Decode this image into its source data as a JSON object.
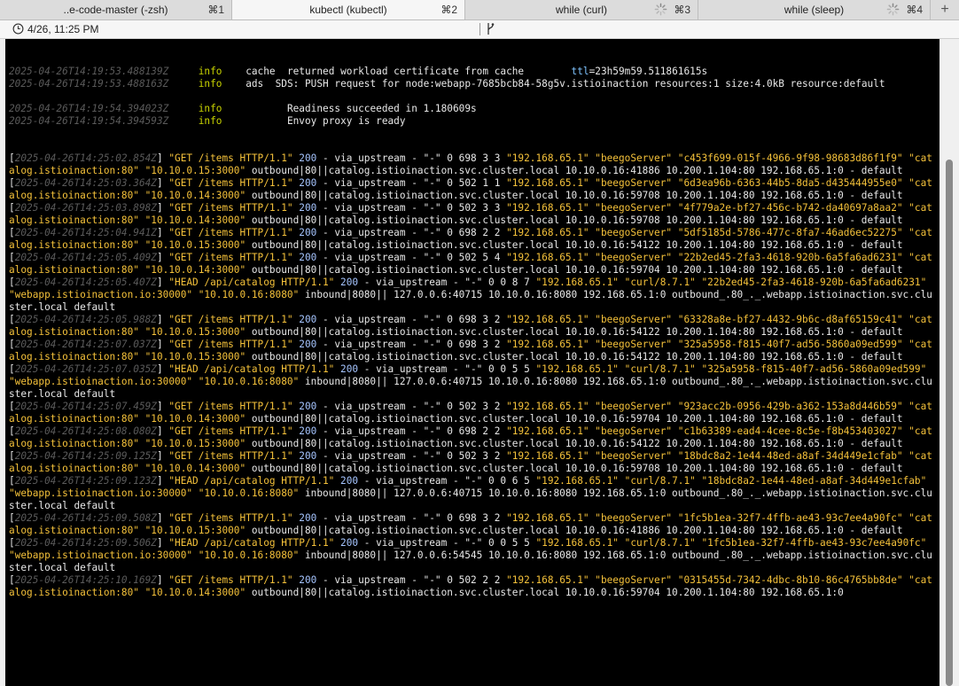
{
  "tabs": [
    {
      "title": "..e-code-master (-zsh)",
      "shortcut": "⌘1",
      "active": false,
      "busy": false
    },
    {
      "title": "kubectl (kubectl)",
      "shortcut": "⌘2",
      "active": true,
      "busy": false
    },
    {
      "title": "while (curl)",
      "shortcut": "⌘3",
      "active": false,
      "busy": true
    },
    {
      "title": "while (sleep)",
      "shortcut": "⌘4",
      "active": false,
      "busy": true
    }
  ],
  "new_tab_label": "+",
  "infobar": {
    "date": "4/26, 11:25 PM"
  },
  "colors": {
    "terminal_bg": "#000000",
    "request": "#f4c13a",
    "timestamp": "#5a5a5a",
    "status": "#a6c5ff",
    "level": "#c9d400"
  },
  "system_logs": [
    {
      "ts": "2025-04-26T14:19:53.488139Z",
      "level": "info",
      "scope": "cache",
      "msg": "returned workload certificate from cache        ",
      "ttl_key": "ttl",
      "ttl_val": "=23h59m59.511861615s"
    },
    {
      "ts": "2025-04-26T14:19:53.488163Z",
      "level": "info",
      "scope": "ads",
      "msg": "SDS: PUSH request for node:webapp-7685bcb84-58g5v.istioinaction resources:1 size:4.0kB resource:default",
      "ttl_key": "",
      "ttl_val": ""
    },
    {
      "ts": "2025-04-26T14:19:54.394023Z",
      "level": "info",
      "scope": "     ",
      "msg": "Readiness succeeded in 1.180609s",
      "ttl_key": "",
      "ttl_val": ""
    },
    {
      "ts": "2025-04-26T14:19:54.394593Z",
      "level": "info",
      "scope": "     ",
      "msg": "Envoy proxy is ready",
      "ttl_key": "",
      "ttl_val": ""
    }
  ],
  "access_logs": [
    {
      "ts": "2025-04-26T14:25:02.854Z",
      "req": "\"GET /items HTTP/1.1\"",
      "status": "200",
      "mid": " - via_upstream - \"-\" 0 698 3 3 ",
      "quoted": "\"192.168.65.1\" \"beegoServer\" \"c453f699-015f-4966-9f98-98683d86f1f9\" \"catalog.istioinaction:80\" \"10.10.0.15:3000\"",
      "tail": " outbound|80||catalog.istioinaction.svc.cluster.local 10.10.0.16:41886 10.200.1.104:80 192.168.65.1:0 - default"
    },
    {
      "ts": "2025-04-26T14:25:03.364Z",
      "req": "\"GET /items HTTP/1.1\"",
      "status": "200",
      "mid": " - via_upstream - \"-\" 0 502 1 1 ",
      "quoted": "\"192.168.65.1\" \"beegoServer\" \"6d3ea96b-6363-44b5-8da5-d435444955e0\" \"catalog.istioinaction:80\" \"10.10.0.14:3000\"",
      "tail": " outbound|80||catalog.istioinaction.svc.cluster.local 10.10.0.16:59708 10.200.1.104:80 192.168.65.1:0 - default"
    },
    {
      "ts": "2025-04-26T14:25:03.898Z",
      "req": "\"GET /items HTTP/1.1\"",
      "status": "200",
      "mid": " - via_upstream - \"-\" 0 502 3 3 ",
      "quoted": "\"192.168.65.1\" \"beegoServer\" \"4f779a2e-bf27-456c-b742-da40697a8aa2\" \"catalog.istioinaction:80\" \"10.10.0.14:3000\"",
      "tail": " outbound|80||catalog.istioinaction.svc.cluster.local 10.10.0.16:59708 10.200.1.104:80 192.168.65.1:0 - default"
    },
    {
      "ts": "2025-04-26T14:25:04.941Z",
      "req": "\"GET /items HTTP/1.1\"",
      "status": "200",
      "mid": " - via_upstream - \"-\" 0 698 2 2 ",
      "quoted": "\"192.168.65.1\" \"beegoServer\" \"5df5185d-5786-477c-8fa7-46ad6ec52275\" \"catalog.istioinaction:80\" \"10.10.0.15:3000\"",
      "tail": " outbound|80||catalog.istioinaction.svc.cluster.local 10.10.0.16:54122 10.200.1.104:80 192.168.65.1:0 - default"
    },
    {
      "ts": "2025-04-26T14:25:05.409Z",
      "req": "\"GET /items HTTP/1.1\"",
      "status": "200",
      "mid": " - via_upstream - \"-\" 0 502 5 4 ",
      "quoted": "\"192.168.65.1\" \"beegoServer\" \"22b2ed45-2fa3-4618-920b-6a5fa6ad6231\" \"catalog.istioinaction:80\" \"10.10.0.14:3000\"",
      "tail": " outbound|80||catalog.istioinaction.svc.cluster.local 10.10.0.16:59704 10.200.1.104:80 192.168.65.1:0 - default"
    },
    {
      "ts": "2025-04-26T14:25:05.407Z",
      "req": "\"HEAD /api/catalog HTTP/1.1\"",
      "status": "200",
      "mid": " - via_upstream - \"-\" 0 0 8 7 ",
      "quoted": "\"192.168.65.1\" \"curl/8.7.1\" \"22b2ed45-2fa3-4618-920b-6a5fa6ad6231\" \"webapp.istioinaction.io:30000\" \"10.10.0.16:8080\"",
      "tail": " inbound|8080|| 127.0.0.6:40715 10.10.0.16:8080 192.168.65.1:0 outbound_.80_._.webapp.istioinaction.svc.cluster.local default"
    },
    {
      "ts": "2025-04-26T14:25:05.988Z",
      "req": "\"GET /items HTTP/1.1\"",
      "status": "200",
      "mid": " - via_upstream - \"-\" 0 698 3 2 ",
      "quoted": "\"192.168.65.1\" \"beegoServer\" \"63328a8e-bf27-4432-9b6c-d8af65159c41\" \"catalog.istioinaction:80\" \"10.10.0.15:3000\"",
      "tail": " outbound|80||catalog.istioinaction.svc.cluster.local 10.10.0.16:54122 10.200.1.104:80 192.168.65.1:0 - default"
    },
    {
      "ts": "2025-04-26T14:25:07.037Z",
      "req": "\"GET /items HTTP/1.1\"",
      "status": "200",
      "mid": " - via_upstream - \"-\" 0 698 3 2 ",
      "quoted": "\"192.168.65.1\" \"beegoServer\" \"325a5958-f815-40f7-ad56-5860a09ed599\" \"catalog.istioinaction:80\" \"10.10.0.15:3000\"",
      "tail": " outbound|80||catalog.istioinaction.svc.cluster.local 10.10.0.16:54122 10.200.1.104:80 192.168.65.1:0 - default"
    },
    {
      "ts": "2025-04-26T14:25:07.035Z",
      "req": "\"HEAD /api/catalog HTTP/1.1\"",
      "status": "200",
      "mid": " - via_upstream - \"-\" 0 0 5 5 ",
      "quoted": "\"192.168.65.1\" \"curl/8.7.1\" \"325a5958-f815-40f7-ad56-5860a09ed599\" \"webapp.istioinaction.io:30000\" \"10.10.0.16:8080\"",
      "tail": " inbound|8080|| 127.0.0.6:40715 10.10.0.16:8080 192.168.65.1:0 outbound_.80_._.webapp.istioinaction.svc.cluster.local default"
    },
    {
      "ts": "2025-04-26T14:25:07.459Z",
      "req": "\"GET /items HTTP/1.1\"",
      "status": "200",
      "mid": " - via_upstream - \"-\" 0 502 3 2 ",
      "quoted": "\"192.168.65.1\" \"beegoServer\" \"923acc2b-0956-429b-a362-153a8d446b59\" \"catalog.istioinaction:80\" \"10.10.0.14:3000\"",
      "tail": " outbound|80||catalog.istioinaction.svc.cluster.local 10.10.0.16:59704 10.200.1.104:80 192.168.65.1:0 - default"
    },
    {
      "ts": "2025-04-26T14:25:08.080Z",
      "req": "\"GET /items HTTP/1.1\"",
      "status": "200",
      "mid": " - via_upstream - \"-\" 0 698 2 2 ",
      "quoted": "\"192.168.65.1\" \"beegoServer\" \"c1b63389-ead4-4cee-8c5e-f8b453403027\" \"catalog.istioinaction:80\" \"10.10.0.15:3000\"",
      "tail": " outbound|80||catalog.istioinaction.svc.cluster.local 10.10.0.16:54122 10.200.1.104:80 192.168.65.1:0 - default"
    },
    {
      "ts": "2025-04-26T14:25:09.125Z",
      "req": "\"GET /items HTTP/1.1\"",
      "status": "200",
      "mid": " - via_upstream - \"-\" 0 502 3 2 ",
      "quoted": "\"192.168.65.1\" \"beegoServer\" \"18bdc8a2-1e44-48ed-a8af-34d449e1cfab\" \"catalog.istioinaction:80\" \"10.10.0.14:3000\"",
      "tail": " outbound|80||catalog.istioinaction.svc.cluster.local 10.10.0.16:59708 10.200.1.104:80 192.168.65.1:0 - default"
    },
    {
      "ts": "2025-04-26T14:25:09.123Z",
      "req": "\"HEAD /api/catalog HTTP/1.1\"",
      "status": "200",
      "mid": " - via_upstream - \"-\" 0 0 6 5 ",
      "quoted": "\"192.168.65.1\" \"curl/8.7.1\" \"18bdc8a2-1e44-48ed-a8af-34d449e1cfab\" \"webapp.istioinaction.io:30000\" \"10.10.0.16:8080\"",
      "tail": " inbound|8080|| 127.0.0.6:40715 10.10.0.16:8080 192.168.65.1:0 outbound_.80_._.webapp.istioinaction.svc.cluster.local default"
    },
    {
      "ts": "2025-04-26T14:25:09.508Z",
      "req": "\"GET /items HTTP/1.1\"",
      "status": "200",
      "mid": " - via_upstream - \"-\" 0 698 3 2 ",
      "quoted": "\"192.168.65.1\" \"beegoServer\" \"1fc5b1ea-32f7-4ffb-ae43-93c7ee4a90fc\" \"catalog.istioinaction:80\" \"10.10.0.15:3000\"",
      "tail": " outbound|80||catalog.istioinaction.svc.cluster.local 10.10.0.16:41886 10.200.1.104:80 192.168.65.1:0 - default"
    },
    {
      "ts": "2025-04-26T14:25:09.506Z",
      "req": "\"HEAD /api/catalog HTTP/1.1\"",
      "status": "200",
      "mid": " - via_upstream - \"-\" 0 0 5 5 ",
      "quoted": "\"192.168.65.1\" \"curl/8.7.1\" \"1fc5b1ea-32f7-4ffb-ae43-93c7ee4a90fc\" \"webapp.istioinaction.io:30000\" \"10.10.0.16:8080\"",
      "tail": " inbound|8080|| 127.0.0.6:54545 10.10.0.16:8080 192.168.65.1:0 outbound_.80_._.webapp.istioinaction.svc.cluster.local default"
    },
    {
      "ts": "2025-04-26T14:25:10.169Z",
      "req": "\"GET /items HTTP/1.1\"",
      "status": "200",
      "mid": " - via_upstream - \"-\" 0 502 2 2 ",
      "quoted": "\"192.168.65.1\" \"beegoServer\" \"0315455d-7342-4dbc-8b10-86c4765bb8de\" \"catalog.istioinaction:80\" \"10.10.0.14:3000\"",
      "tail": " outbound|80||catalog.istioinaction.svc.cluster.local 10.10.0.16:59704 10.200.1.104:80 192.168.65.1:0"
    }
  ]
}
